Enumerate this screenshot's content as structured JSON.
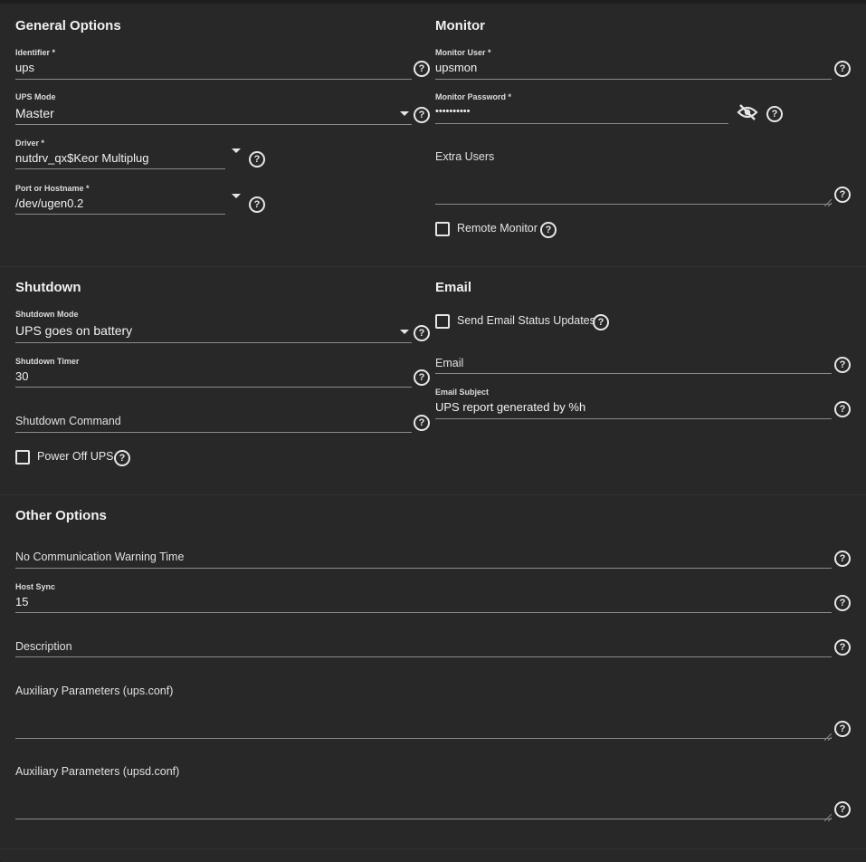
{
  "general": {
    "title": "General Options",
    "identifier": {
      "label": "Identifier *",
      "value": "ups"
    },
    "ups_mode": {
      "label": "UPS Mode",
      "value": "Master"
    },
    "driver": {
      "label": "Driver *",
      "value": "nutdrv_qx$Keor Multiplug"
    },
    "port": {
      "label": "Port or Hostname *",
      "value": "/dev/ugen0.2"
    }
  },
  "monitor": {
    "title": "Monitor",
    "user": {
      "label": "Monitor User *",
      "value": "upsmon"
    },
    "password": {
      "label": "Monitor Password *",
      "value": "••••••••••"
    },
    "extra_users": {
      "label": "Extra Users"
    },
    "remote_monitor": {
      "label": "Remote Monitor",
      "checked": false
    }
  },
  "shutdown": {
    "title": "Shutdown",
    "mode": {
      "label": "Shutdown Mode",
      "value": "UPS goes on battery"
    },
    "timer": {
      "label": "Shutdown Timer",
      "value": "30"
    },
    "command": {
      "label": "Shutdown Command"
    },
    "power_off": {
      "label": "Power Off UPS",
      "checked": false
    }
  },
  "email": {
    "title": "Email",
    "send_updates": {
      "label": "Send Email Status Updates",
      "checked": false
    },
    "email": {
      "label": "Email"
    },
    "subject": {
      "label": "Email Subject",
      "value": "UPS report generated by %h"
    }
  },
  "other": {
    "title": "Other Options",
    "no_comm": {
      "label": "No Communication Warning Time"
    },
    "host_sync": {
      "label": "Host Sync",
      "value": "15"
    },
    "description": {
      "label": "Description"
    },
    "aux_ups": {
      "label": "Auxiliary Parameters (ups.conf)"
    },
    "aux_upsd": {
      "label": "Auxiliary Parameters (upsd.conf)"
    }
  },
  "icons": {
    "help": "?",
    "help_icon": "help-circle-icon",
    "visibility_icon": "eye-off-icon",
    "dropdown_icon": "caret-down-icon"
  },
  "colors": {
    "background": "#1e1e1e",
    "card": "#282828",
    "text": "#e6e6e6",
    "underline": "#8a8a8a"
  }
}
